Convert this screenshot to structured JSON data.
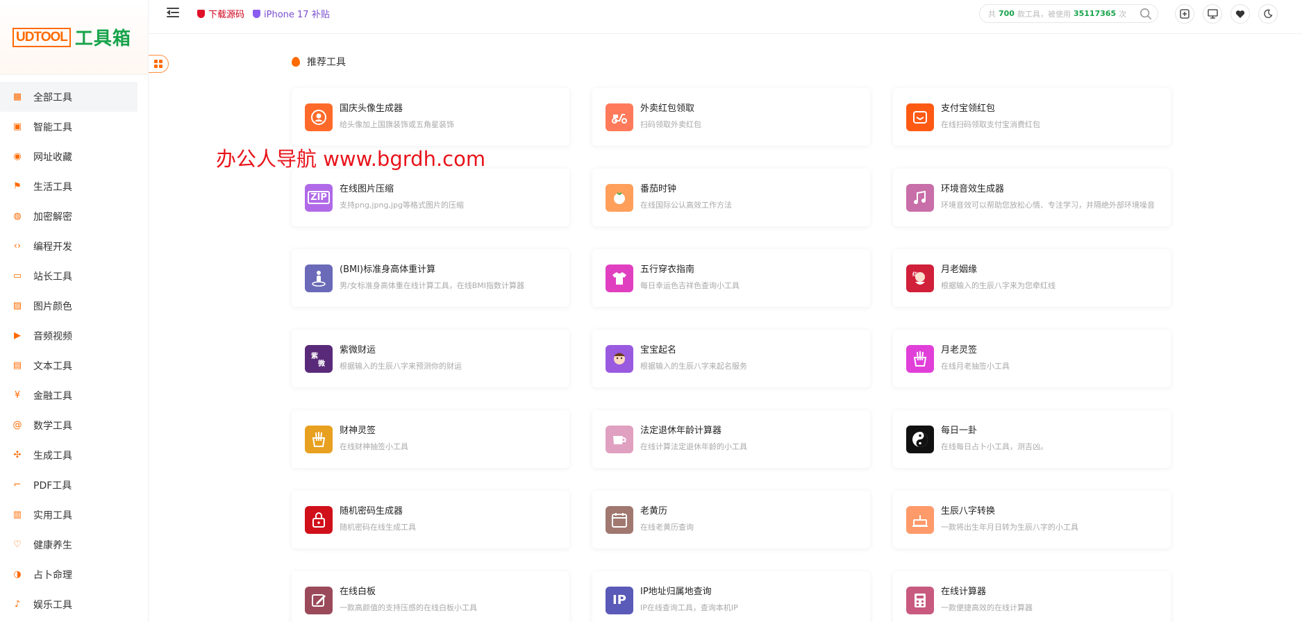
{
  "logo": {
    "part1": "UDTOOL",
    "part2": "工具箱"
  },
  "sidebar": {
    "items": [
      {
        "label": "全部工具",
        "icon": "grid-icon"
      },
      {
        "label": "智能工具",
        "icon": "ai-icon"
      },
      {
        "label": "网址收藏",
        "icon": "browser-icon"
      },
      {
        "label": "生活工具",
        "icon": "flag-icon"
      },
      {
        "label": "加密解密",
        "icon": "lock-icon"
      },
      {
        "label": "编程开发",
        "icon": "code-icon"
      },
      {
        "label": "站长工具",
        "icon": "monitor-icon"
      },
      {
        "label": "图片颜色",
        "icon": "image-icon"
      },
      {
        "label": "音频视频",
        "icon": "play-icon"
      },
      {
        "label": "文本工具",
        "icon": "document-icon"
      },
      {
        "label": "金融工具",
        "icon": "yen-icon"
      },
      {
        "label": "数学工具",
        "icon": "at-icon"
      },
      {
        "label": "生成工具",
        "icon": "fan-icon"
      },
      {
        "label": "PDF工具",
        "icon": "pdf-icon"
      },
      {
        "label": "实用工具",
        "icon": "toolbox-icon"
      },
      {
        "label": "健康养生",
        "icon": "heart-icon"
      },
      {
        "label": "占卜命理",
        "icon": "taichi-icon"
      },
      {
        "label": "娱乐工具",
        "icon": "music-note-icon"
      }
    ]
  },
  "header": {
    "promo1": "下载源码",
    "promo2": "iPhone 17 补贴",
    "search": {
      "prefix": "共",
      "tool_count": "700",
      "middle": "款工具，被使用",
      "use_count": "35117365",
      "suffix": "次"
    }
  },
  "section_title": "推荐工具",
  "watermark": "办公人导航 www.bgrdh.com",
  "colors": {
    "accent": "#ff6a00",
    "brand_green": "#17a34a",
    "watermark_red": "#e8141b"
  },
  "cards": [
    {
      "title": "国庆头像生成器",
      "desc": "给头像加上国旗装饰或五角星装饰",
      "icon": "avatar-icon",
      "color": "#ff6a2a"
    },
    {
      "title": "外卖红包领取",
      "desc": "扫码领取外卖红包",
      "icon": "scooter-icon",
      "color": "#ff7a5a"
    },
    {
      "title": "支付宝领红包",
      "desc": "在线扫码领取支付宝消费红包",
      "icon": "wallet-icon",
      "color": "#ff5a14"
    },
    {
      "title": "在线图片压缩",
      "desc": "支持png,jpng,jpg等格式图片的压缩",
      "icon": "zip-icon",
      "icon_text": "ZIP",
      "color": "#b06ae8"
    },
    {
      "title": "番茄时钟",
      "desc": "在线国际公认高效工作方法",
      "icon": "tomato-icon",
      "color": "#ff9f5a"
    },
    {
      "title": "环境音效生成器",
      "desc": "环境音效可以帮助您放松心情、专注学习，并隔绝外部环境噪音",
      "icon": "music-icon",
      "color": "#c86ea8"
    },
    {
      "title": "(BMI)标准身高体重计算",
      "desc": "男/女标准身高体重在线计算工具，在线BMI指数计算器",
      "icon": "person-icon",
      "color": "#6a6ab8"
    },
    {
      "title": "五行穿衣指南",
      "desc": "每日幸运色吉祥色查询小工具",
      "icon": "shirt-icon",
      "color": "#e040c0"
    },
    {
      "title": "月老姻缘",
      "desc": "根据输入的生辰八字来为您牵红线",
      "icon": "matchmaker-icon",
      "color": "#d0203a"
    },
    {
      "title": "紫微财运",
      "desc": "根据输入的生辰八字来预测你的财运",
      "icon": "calligraphy-icon",
      "color": "#5a2a7a"
    },
    {
      "title": "宝宝起名",
      "desc": "根据输入的生辰八字来起名服务",
      "icon": "baby-icon",
      "color": "#9a5ae0"
    },
    {
      "title": "月老灵签",
      "desc": "在线月老抽签小工具",
      "icon": "lots-icon",
      "color": "#e040d8"
    },
    {
      "title": "财神灵签",
      "desc": "在线财神抽签小工具",
      "icon": "lots-icon",
      "color": "#e8a020"
    },
    {
      "title": "法定退休年龄计算器",
      "desc": "在线计算法定退休年龄的小工具",
      "icon": "cup-icon",
      "color": "#e0a0c0"
    },
    {
      "title": "每日一卦",
      "desc": "在线每日占卜小工具，测吉凶。",
      "icon": "taichi-icon",
      "color": "#111111"
    },
    {
      "title": "随机密码生成器",
      "desc": "随机密码在线生成工具",
      "icon": "padlock-icon",
      "color": "#d0101a"
    },
    {
      "title": "老黄历",
      "desc": "在线老黄历查询",
      "icon": "calendar-icon",
      "color": "#a07870"
    },
    {
      "title": "生辰八字转换",
      "desc": "一款将出生年月日转为生辰八字的小工具",
      "icon": "cake-icon",
      "color": "#ff9a6a"
    },
    {
      "title": "在线白板",
      "desc": "一款高颜值的支持压感的在线白板小工具",
      "icon": "whiteboard-icon",
      "color": "#9a4a5a"
    },
    {
      "title": "IP地址归属地查询",
      "desc": "IP在线查询工具，查询本机IP",
      "icon": "ip-icon",
      "icon_text": "IP",
      "color": "#5a5ab8"
    },
    {
      "title": "在线计算器",
      "desc": "一款便捷高效的在线计算器",
      "icon": "calculator-icon",
      "color": "#c85a80"
    }
  ]
}
